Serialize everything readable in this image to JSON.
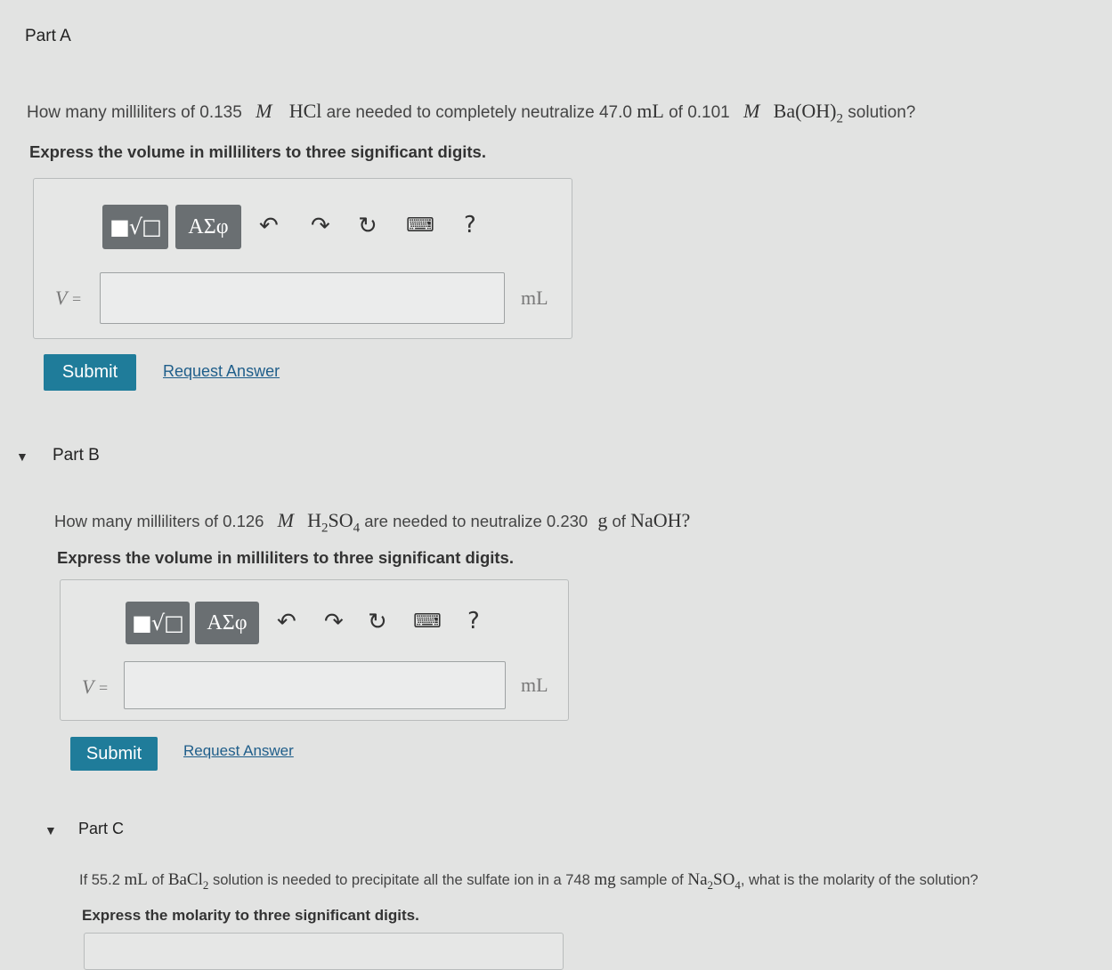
{
  "part_a": {
    "title": "Part A",
    "q_pre": "How many milliliters of 0.135",
    "q_m1": "M",
    "q_hcl": "HCl",
    "q_mid": "are needed to completely neutralize 47.0",
    "q_ml": "mL",
    "q_of": "of 0.101",
    "q_m2": "M",
    "q_base": "Ba(OH)",
    "q_sub": "2",
    "q_post": "solution?",
    "instruction": "Express the volume in milliliters to three significant digits.",
    "var": "V",
    "eq": "=",
    "unit": "mL",
    "submit": "Submit",
    "request": "Request Answer"
  },
  "part_b": {
    "title": "Part B",
    "q_pre": "How many milliliters of 0.126",
    "q_m": "M",
    "q_acid": "H",
    "q_sub1": "2",
    "q_acid2": "SO",
    "q_sub2": "4",
    "q_mid": "are needed to neutralize 0.230",
    "q_g": "g",
    "q_of": "of",
    "q_naoh": "NaOH?",
    "instruction": "Express the volume in milliliters to three significant digits.",
    "var": "V",
    "eq": "=",
    "unit": "mL",
    "submit": "Submit",
    "request": "Request Answer"
  },
  "part_c": {
    "title": "Part C",
    "q_pre": "If 55.2",
    "q_ml": "mL",
    "q_of": "of",
    "q_bacl": "BaCl",
    "q_sub1": "2",
    "q_mid": "solution is needed to precipitate all the sulfate ion in a 748",
    "q_mg": "mg",
    "q_sample": "sample of",
    "q_na": "Na",
    "q_sub2": "2",
    "q_so": "SO",
    "q_sub3": "4",
    "q_post": ", what is the molarity of the solution?",
    "instruction": "Express the molarity to three significant digits."
  },
  "toolbar": {
    "templates_icon": "square-root-template-icon",
    "greek_label": "ΑΣφ",
    "undo_icon": "undo-icon",
    "redo_icon": "redo-icon",
    "reset_icon": "reset-icon",
    "keyboard_icon": "keyboard-icon",
    "help_label": "?"
  },
  "colors": {
    "background": "#e2e3e2",
    "toolbar_button": "#6a6f72",
    "submit_button": "#1f7c9a",
    "link": "#1f5e8a"
  }
}
